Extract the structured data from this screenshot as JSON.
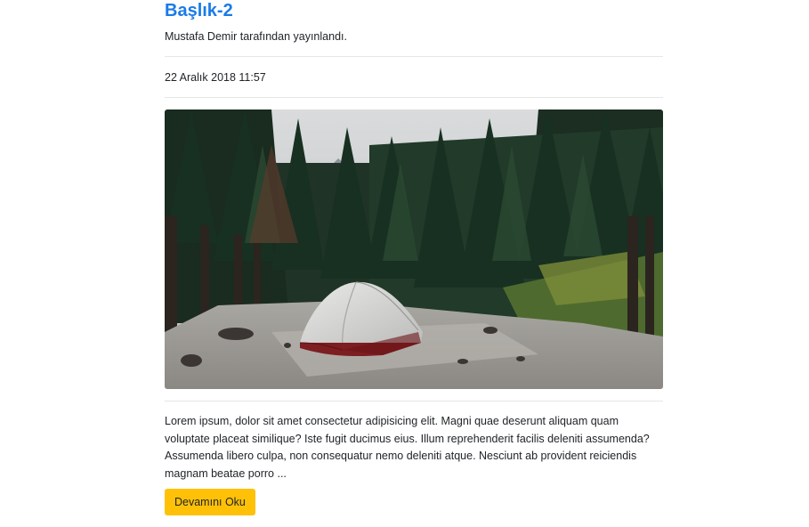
{
  "post": {
    "title": "Başlık-2",
    "author_line": "Mustafa Demir tarafından yayınlandı.",
    "date": "22 Aralık 2018 11:57",
    "image_subject": "tent in forest clearing",
    "excerpt": "Lorem ipsum, dolor sit amet consectetur adipisicing elit. Magni quae deserunt aliquam quam voluptate placeat similique? Iste fugit ducimus eius. Illum reprehenderit facilis deleniti assumenda? Assumenda libero culpa, non consequatur nemo deleniti atque. Nesciunt ab provident reiciendis magnam beatae porro ...",
    "read_more_label": "Devamını Oku"
  },
  "colors": {
    "title": "#1a7be8",
    "button": "#ffc107",
    "separator": "#e4e6e8",
    "text": "#212529"
  }
}
